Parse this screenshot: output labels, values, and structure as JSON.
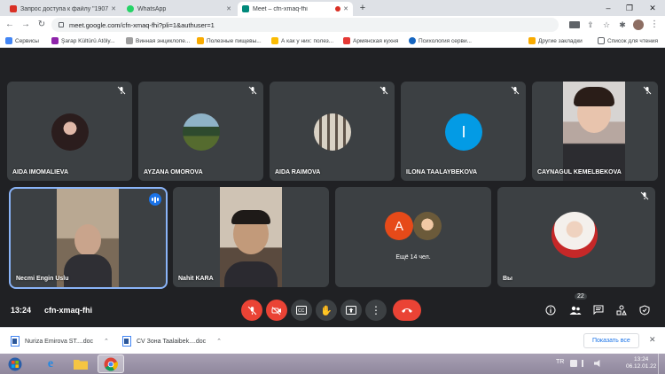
{
  "browser": {
    "tabs": [
      {
        "title": "Запрос доступа к файлу \"1907...",
        "color": "#d93025",
        "active": false
      },
      {
        "title": "WhatsApp",
        "color": "#25d366",
        "active": false
      },
      {
        "title": "Meet – cfn-xmaq-fhi",
        "color": "#00897b",
        "active": true
      }
    ],
    "url": "meet.google.com/cfn-xmaq-fhi?pli=1&authuser=1",
    "bookmarks": [
      {
        "label": "Сервисы",
        "color": "#4285f4"
      },
      {
        "label": "Şarap Kültürü Atöly...",
        "color": "#8e24aa"
      },
      {
        "label": "Винная энциклопе...",
        "color": "#9e9e9e"
      },
      {
        "label": "Полезные пищевы...",
        "color": "#f9ab00"
      },
      {
        "label": "А как у них: полез...",
        "color": "#fbbc04"
      },
      {
        "label": "Армянская кухня",
        "color": "#e53935"
      },
      {
        "label": "Психология серви...",
        "color": "#1565c0"
      }
    ],
    "other_bookmarks": "Другие закладки",
    "reading_list": "Список для чтения"
  },
  "meet": {
    "participants_row1": [
      {
        "name": "AIDA IMOMALIEVA",
        "muted": true
      },
      {
        "name": "AYZANA OMOROVA",
        "muted": true
      },
      {
        "name": "AIDA RAIMOVA",
        "muted": true
      },
      {
        "name": "ILONA TAALAYBEKOVA",
        "muted": true,
        "initial": "I",
        "avatar_color": "#039be5"
      },
      {
        "name": "CAYNAGUL KEMELBEKOVA",
        "muted": true
      }
    ],
    "participants_row2": [
      {
        "name": "Necmi Engin Uslu",
        "speaking": true
      },
      {
        "name": "Nahit KARA"
      },
      {
        "name": "Ещё 14 чел.",
        "initial": "A",
        "avatar_color": "#e64a19"
      },
      {
        "name": "Вы",
        "muted": true
      }
    ],
    "time": "13:24",
    "meeting_code": "cfn-xmaq-fhi",
    "people_count": "22"
  },
  "downloads": [
    {
      "filename": "Nuriza Emirova ST....doc"
    },
    {
      "filename": "CV Зона Taalaibek....doc"
    }
  ],
  "show_all": "Показать все",
  "taskbar": {
    "lang": "TR",
    "time": "13:24",
    "date": "06.12.01.22"
  }
}
